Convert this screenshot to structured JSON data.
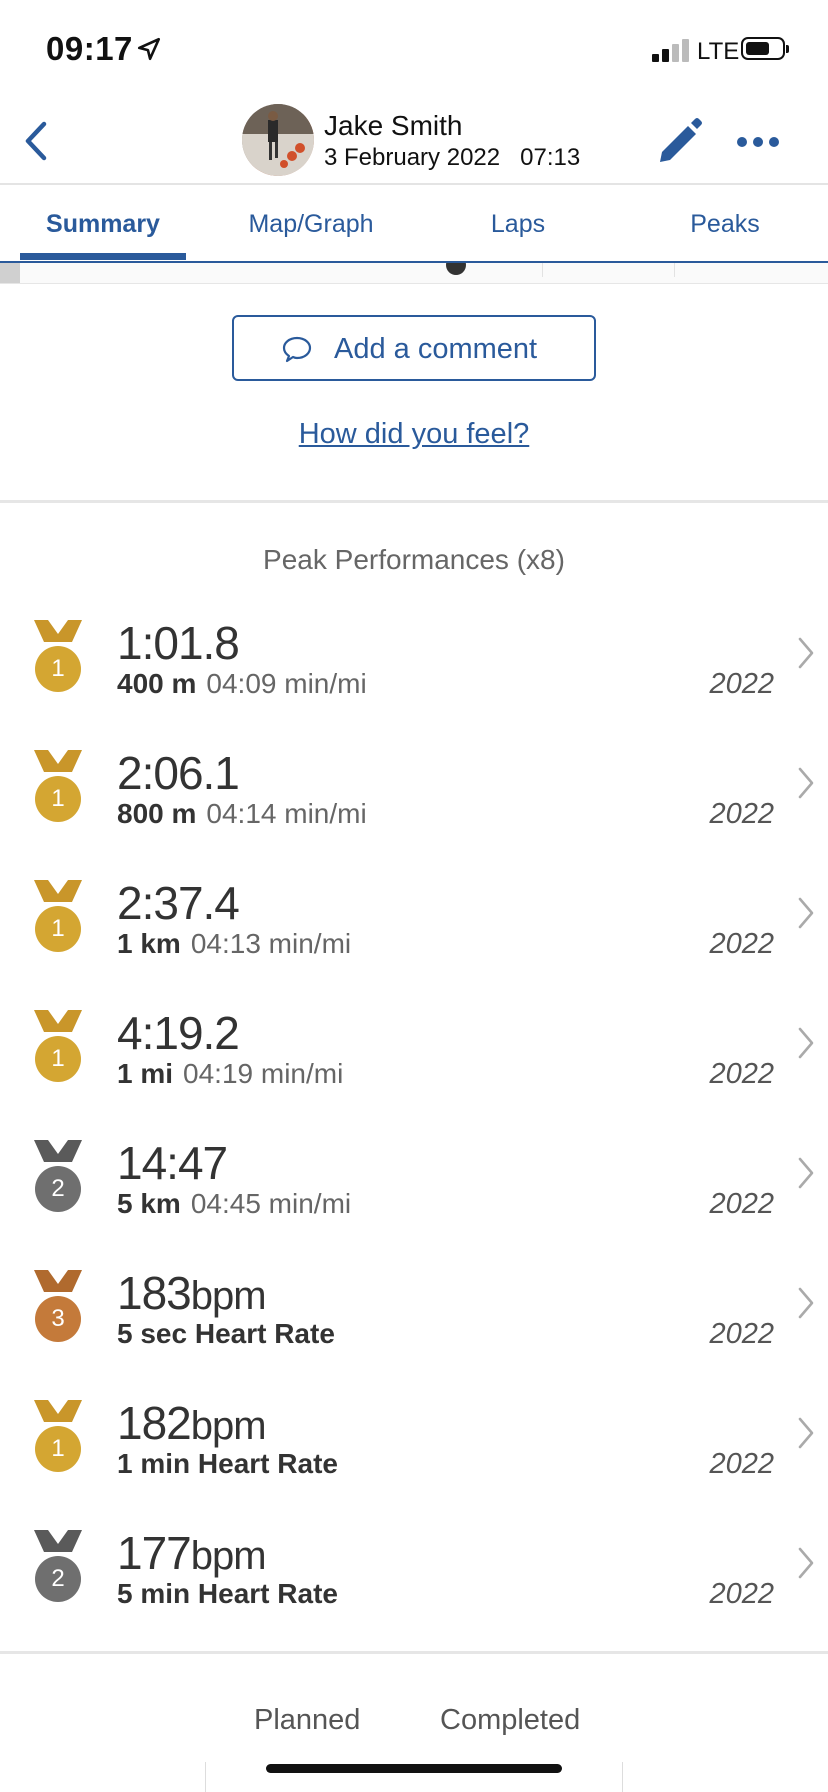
{
  "status": {
    "time": "09:17",
    "network": "LTE"
  },
  "header": {
    "name": "Jake Smith",
    "date": "3 February 2022",
    "time": "07:13"
  },
  "tabs": [
    {
      "label": "Summary",
      "active": true
    },
    {
      "label": "Map/Graph"
    },
    {
      "label": "Laps"
    },
    {
      "label": "Peaks"
    }
  ],
  "comment": {
    "label": "Add a comment",
    "feel_link": "How did you feel?"
  },
  "peaks": {
    "title": "Peak Performances (x8)",
    "items": [
      {
        "rank": "1",
        "medal": "gold",
        "value": "1:01.8",
        "unit": "",
        "distance": "400 m",
        "pace": "04:09 min/mi",
        "year": "2022"
      },
      {
        "rank": "1",
        "medal": "gold",
        "value": "2:06.1",
        "unit": "",
        "distance": "800 m",
        "pace": "04:14 min/mi",
        "year": "2022"
      },
      {
        "rank": "1",
        "medal": "gold",
        "value": "2:37.4",
        "unit": "",
        "distance": "1 km",
        "pace": "04:13 min/mi",
        "year": "2022"
      },
      {
        "rank": "1",
        "medal": "gold",
        "value": "4:19.2",
        "unit": "",
        "distance": "1 mi",
        "pace": "04:19 min/mi",
        "year": "2022"
      },
      {
        "rank": "2",
        "medal": "silver",
        "value": "14:47",
        "unit": "",
        "distance": "5 km",
        "pace": "04:45 min/mi",
        "year": "2022"
      },
      {
        "rank": "3",
        "medal": "bronze",
        "value": "183",
        "unit": "bpm",
        "distance": "5 sec Heart Rate",
        "pace": "",
        "year": "2022"
      },
      {
        "rank": "1",
        "medal": "gold",
        "value": "182",
        "unit": "bpm",
        "distance": "1 min Heart Rate",
        "pace": "",
        "year": "2022"
      },
      {
        "rank": "2",
        "medal": "silver",
        "value": "177",
        "unit": "bpm",
        "distance": "5 min Heart Rate",
        "pace": "",
        "year": "2022"
      }
    ]
  },
  "bottom": {
    "planned": "Planned",
    "completed": "Completed"
  },
  "colors": {
    "accent": "#2a5a9b",
    "gold": "#d4a632",
    "silver": "#6f6f6f",
    "bronze": "#c47a3a"
  }
}
